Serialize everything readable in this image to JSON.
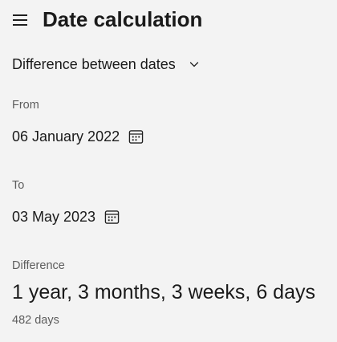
{
  "header": {
    "title": "Date calculation",
    "menu_icon": "hamburger-menu-icon"
  },
  "mode": {
    "selected": "Difference between dates",
    "icon": "chevron-down-icon"
  },
  "from": {
    "label": "From",
    "value": "06 January 2022",
    "icon": "calendar-icon"
  },
  "to": {
    "label": "To",
    "value": "03 May 2023",
    "icon": "calendar-icon"
  },
  "difference": {
    "label": "Difference",
    "result": "1 year, 3 months, 3 weeks, 6 days",
    "days": "482 days"
  },
  "colors": {
    "background": "#f3f3f3",
    "text_primary": "#1a1a1a",
    "text_secondary": "#5d5d5d"
  }
}
